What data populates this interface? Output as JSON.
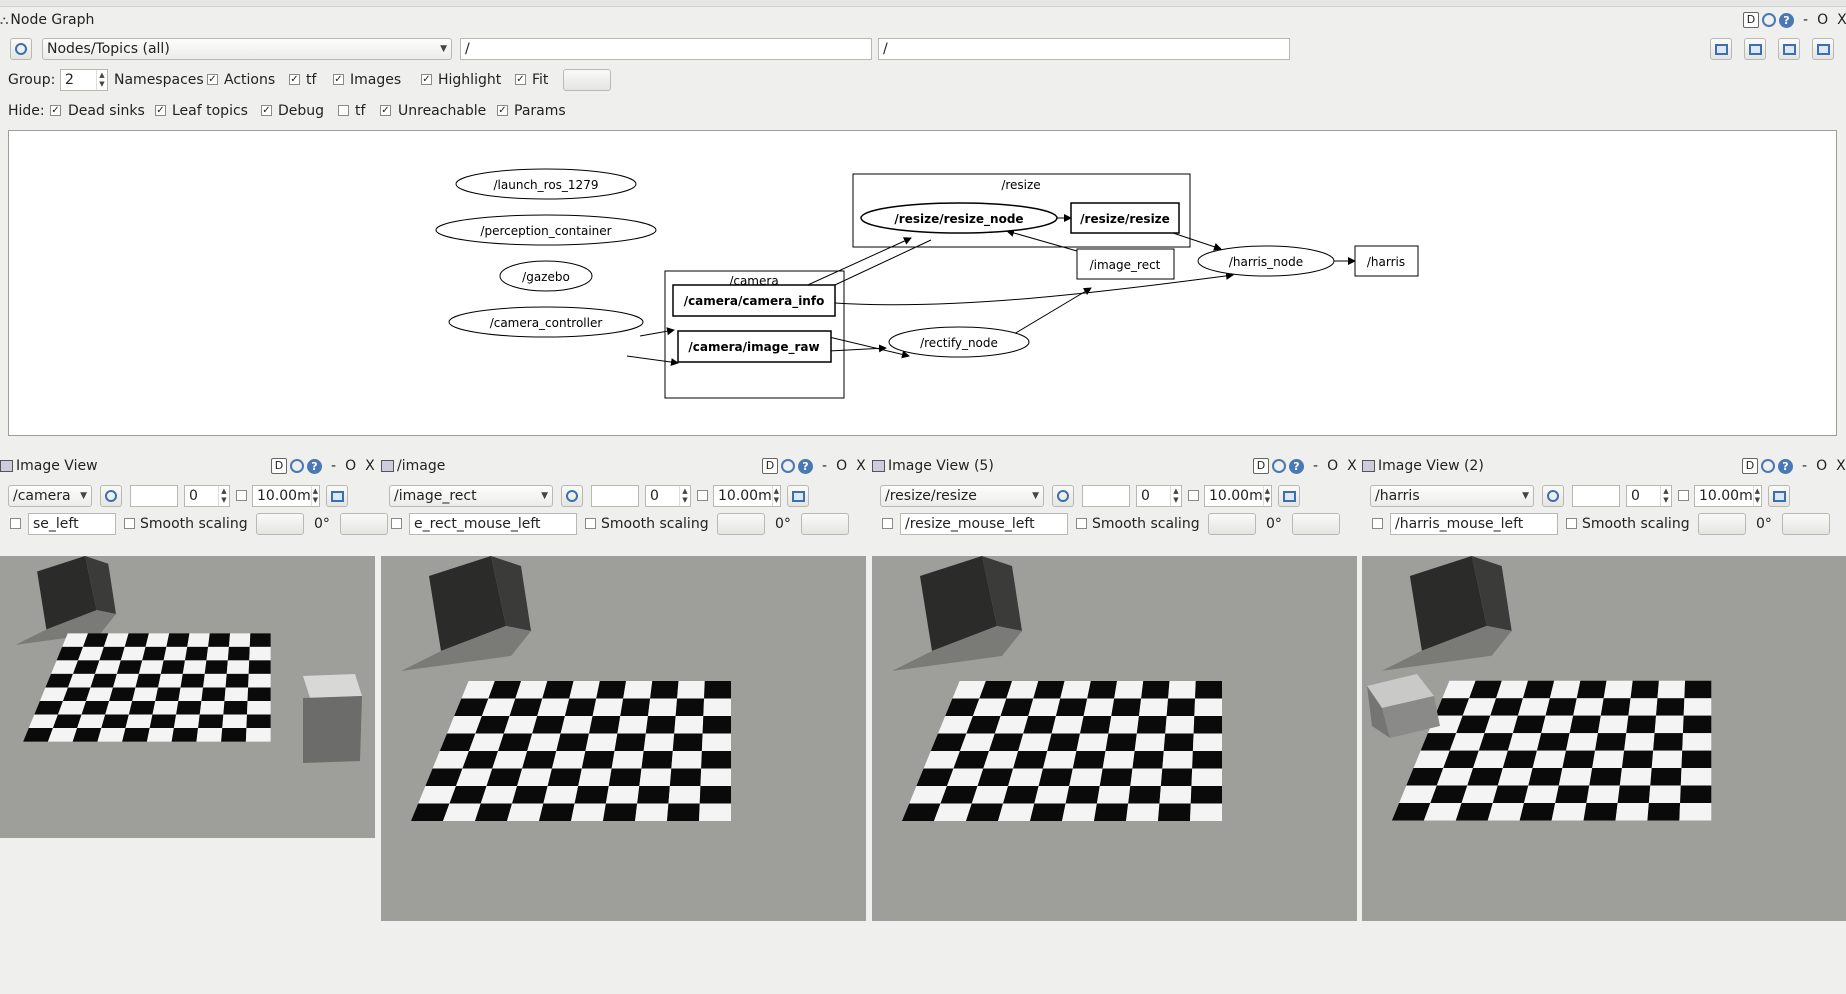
{
  "node_graph": {
    "title": "Node Graph",
    "dock_buttons": {
      "d": "D",
      "help": "?",
      "min": "-",
      "float": "O",
      "close": "X"
    },
    "mode_combo": "Nodes/Topics (all)",
    "filter_node": "/",
    "filter_topic": "/",
    "group_label": "Group:",
    "group_value": "2",
    "row1": {
      "namespaces": "Namespaces",
      "actions": "Actions",
      "tf": "tf",
      "images": "Images",
      "highlight": "Highlight",
      "fit": "Fit"
    },
    "hide_label": "Hide:",
    "row2": {
      "dead_sinks": "Dead sinks",
      "leaf_topics": "Leaf topics",
      "debug": "Debug",
      "tf": "tf",
      "unreachable": "Unreachable",
      "params": "Params"
    },
    "graph": {
      "nodes": {
        "launch_ros": "/launch_ros_1279",
        "perception": "/perception_container",
        "gazebo": "/gazebo",
        "camera_controller": "/camera_controller",
        "resize_node": "/resize/resize_node",
        "rectify_node": "/rectify_node",
        "harris_node": "/harris_node"
      },
      "topics": {
        "camera_info": "/camera/camera_info",
        "image_raw": "/camera/image_raw",
        "resize_resize": "/resize/resize",
        "image_rect": "/image_rect",
        "harris": "/harris"
      },
      "groups": {
        "camera": "/camera",
        "resize": "/resize"
      }
    }
  },
  "image_views": [
    {
      "title": "Image View",
      "topic": "/camera",
      "num": "0",
      "time": "10.00m",
      "mouse_topic": "se_left",
      "smooth": "Smooth scaling",
      "rot": "0°"
    },
    {
      "title": "/image",
      "topic": "/image_rect",
      "num": "0",
      "time": "10.00m",
      "mouse_topic": "e_rect_mouse_left",
      "smooth": "Smooth scaling",
      "rot": "0°"
    },
    {
      "title": "Image View (5)",
      "topic": "/resize/resize",
      "num": "0",
      "time": "10.00m",
      "mouse_topic": "/resize_mouse_left",
      "smooth": "Smooth scaling",
      "rot": "0°"
    },
    {
      "title": "Image View (2)",
      "topic": "/harris",
      "num": "0",
      "time": "10.00m",
      "mouse_topic": "/harris_mouse_left",
      "smooth": "Smooth scaling",
      "rot": "0°"
    }
  ]
}
